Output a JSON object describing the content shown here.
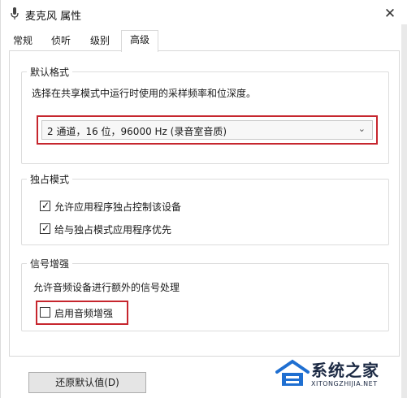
{
  "window": {
    "title": "麦克风 属性",
    "close_symbol": "✕"
  },
  "tabs": [
    {
      "label": "常规"
    },
    {
      "label": "侦听"
    },
    {
      "label": "级别"
    },
    {
      "label": "高级",
      "active": true
    }
  ],
  "default_format": {
    "legend": "默认格式",
    "description": "选择在共享模式中运行时使用的采样频率和位深度。",
    "selected": "2 通道，16 位，96000 Hz (录音室音质)"
  },
  "exclusive_mode": {
    "legend": "独占模式",
    "options": [
      {
        "label": "允许应用程序独占控制该设备",
        "checked": true
      },
      {
        "label": "给与独占模式应用程序优先",
        "checked": true
      }
    ]
  },
  "signal_enhance": {
    "legend": "信号增强",
    "description": "允许音频设备进行额外的信号处理",
    "option": {
      "label": "启用音频增强",
      "checked": false
    }
  },
  "buttons": {
    "restore_default": "还原默认值(D)"
  },
  "watermark": {
    "name": "系统之家",
    "url": "XITONGZHIJIA.NET"
  },
  "colors": {
    "highlight": "#c6262e",
    "logo_blue": "#1f6fd1"
  },
  "icons": {
    "checked": "✓",
    "chevron": "⌄"
  }
}
